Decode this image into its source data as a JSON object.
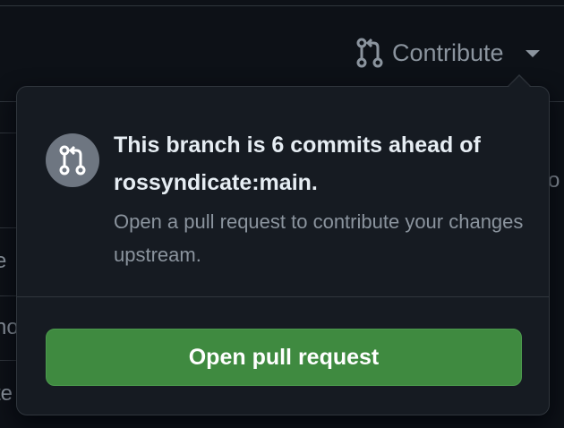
{
  "contribute": {
    "label": "Contribute",
    "icon": "git-pull-request-icon",
    "caret_icon": "chevron-down-icon"
  },
  "popover": {
    "icon": "git-pull-request-icon",
    "heading": "This branch is 6 commits ahead of rossyndicate:main.",
    "description": "Open a pull request to contribute your changes upstream.",
    "button_label": "Open pull request",
    "colors": {
      "background": "#161b22",
      "button": "#3f8a40",
      "icon_circle": "#6e7681"
    }
  },
  "background_fragments": {
    "left": [
      "e",
      "no",
      "te"
    ],
    "right": "o"
  }
}
